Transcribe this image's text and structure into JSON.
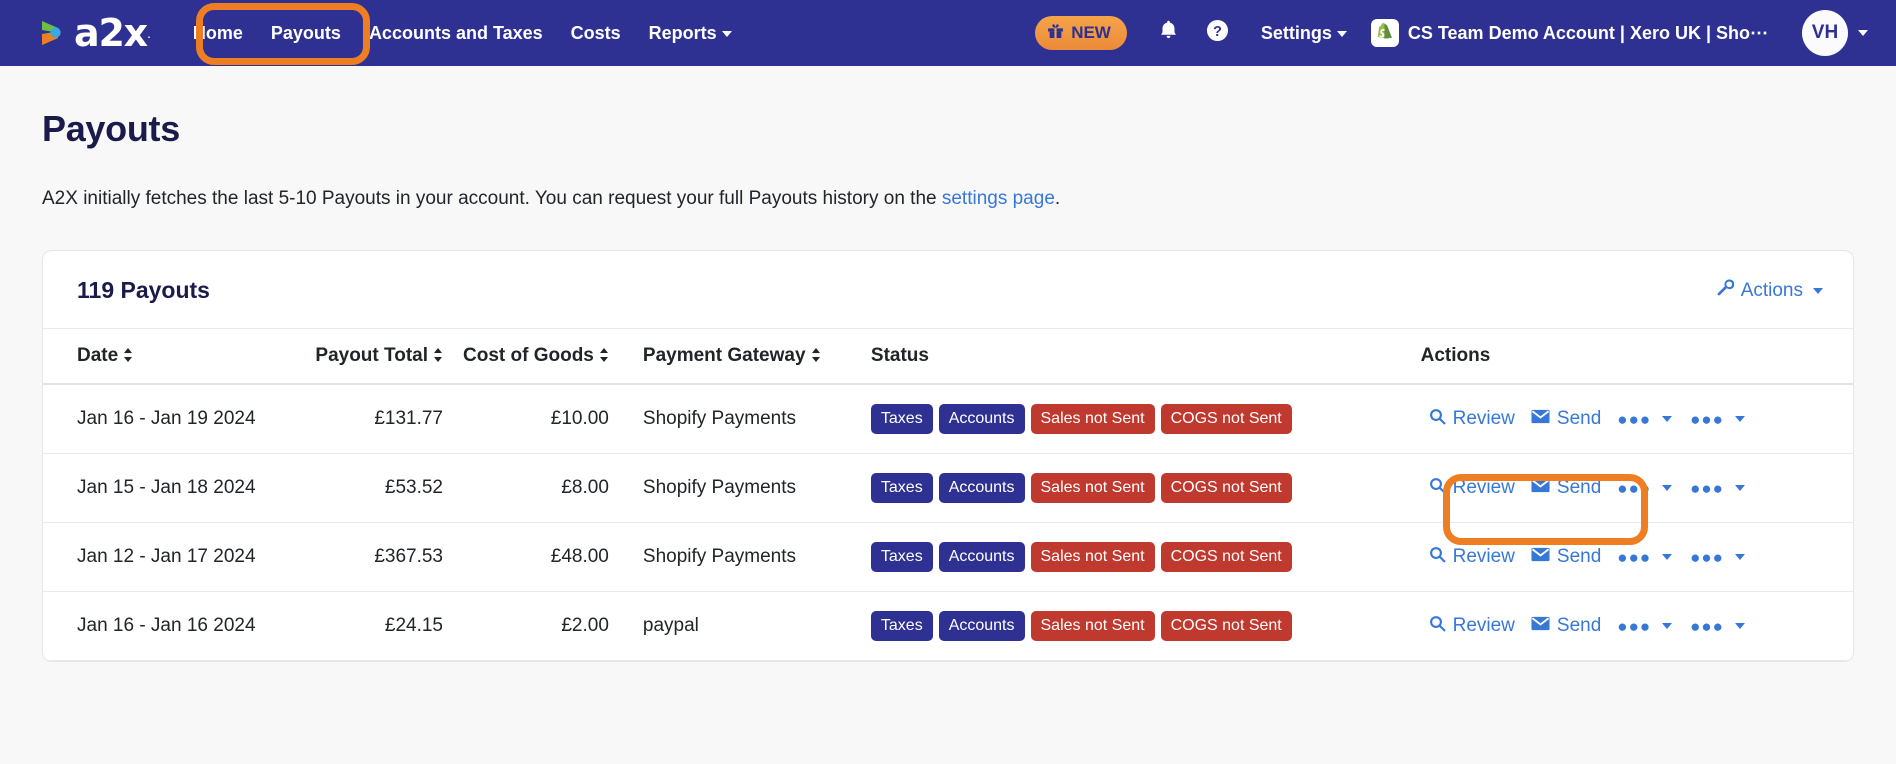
{
  "header": {
    "logo_text": "a2x",
    "nav_links": [
      {
        "label": "Home",
        "has_caret": false
      },
      {
        "label": "Payouts",
        "has_caret": false
      },
      {
        "label": "Accounts and Taxes",
        "has_caret": false
      },
      {
        "label": "Costs",
        "has_caret": false
      },
      {
        "label": "Reports",
        "has_caret": true
      }
    ],
    "new_badge": "NEW",
    "settings_label": "Settings",
    "account_name": "CS Team Demo Account | Xero UK | Sho⋯",
    "avatar_initials": "VH",
    "brand_color": "#2e3192",
    "accent_color": "#ef7d22"
  },
  "page": {
    "title": "Payouts",
    "description_prefix": "A2X initially fetches the last 5-10 Payouts in your account. You can request your full Payouts history on the ",
    "description_link": "settings page",
    "description_suffix": "."
  },
  "card": {
    "title": "119 Payouts",
    "actions_label": "Actions"
  },
  "table": {
    "columns": [
      {
        "label": "Date",
        "sortable": true,
        "align": "left"
      },
      {
        "label": "Payout Total",
        "sortable": true,
        "align": "right"
      },
      {
        "label": "Cost of Goods",
        "sortable": true,
        "align": "right"
      },
      {
        "label": "Payment Gateway",
        "sortable": true,
        "align": "left"
      },
      {
        "label": "Status",
        "sortable": false,
        "align": "left"
      },
      {
        "label": "Actions",
        "sortable": false,
        "align": "left"
      }
    ],
    "rows": [
      {
        "date": "Jan 16 - Jan 19 2024",
        "payout_total": "£131.77",
        "cost_of_goods": "£10.00",
        "payment_gateway": "Shopify Payments",
        "badges": [
          {
            "label": "Taxes",
            "color": "navy"
          },
          {
            "label": "Accounts",
            "color": "navy"
          },
          {
            "label": "Sales not Sent",
            "color": "red"
          },
          {
            "label": "COGS not Sent",
            "color": "red"
          }
        ],
        "review_label": "Review",
        "send_label": "Send"
      },
      {
        "date": "Jan 15 - Jan 18 2024",
        "payout_total": "£53.52",
        "cost_of_goods": "£8.00",
        "payment_gateway": "Shopify Payments",
        "badges": [
          {
            "label": "Taxes",
            "color": "navy"
          },
          {
            "label": "Accounts",
            "color": "navy"
          },
          {
            "label": "Sales not Sent",
            "color": "red"
          },
          {
            "label": "COGS not Sent",
            "color": "red"
          }
        ],
        "review_label": "Review",
        "send_label": "Send"
      },
      {
        "date": "Jan 12 - Jan 17 2024",
        "payout_total": "£367.53",
        "cost_of_goods": "£48.00",
        "payment_gateway": "Shopify Payments",
        "badges": [
          {
            "label": "Taxes",
            "color": "navy"
          },
          {
            "label": "Accounts",
            "color": "navy"
          },
          {
            "label": "Sales not Sent",
            "color": "red"
          },
          {
            "label": "COGS not Sent",
            "color": "red"
          }
        ],
        "review_label": "Review",
        "send_label": "Send"
      },
      {
        "date": "Jan 16 - Jan 16 2024",
        "payout_total": "£24.15",
        "cost_of_goods": "£2.00",
        "payment_gateway": "paypal",
        "badges": [
          {
            "label": "Taxes",
            "color": "navy"
          },
          {
            "label": "Accounts",
            "color": "navy"
          },
          {
            "label": "Sales not Sent",
            "color": "red"
          },
          {
            "label": "COGS not Sent",
            "color": "red"
          }
        ],
        "review_label": "Review",
        "send_label": "Send"
      }
    ]
  },
  "annotations": [
    {
      "name": "nav-highlight",
      "target": "Payouts nav area"
    },
    {
      "name": "review-highlight",
      "target": "Review action of first row"
    }
  ]
}
